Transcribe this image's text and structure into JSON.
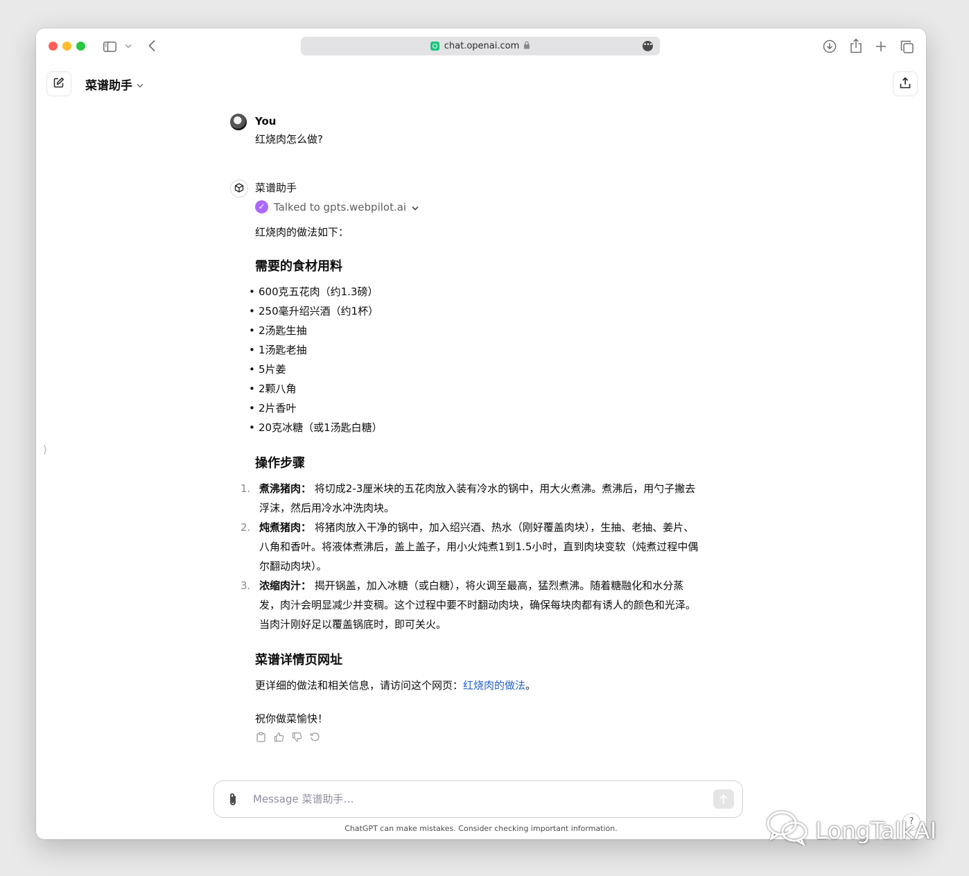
{
  "browser": {
    "url": "chat.openai.com"
  },
  "header": {
    "gpt_name": "菜谱助手"
  },
  "conversation": {
    "user": {
      "name": "You",
      "message": "红烧肉怎么做?"
    },
    "assistant": {
      "name": "菜谱助手",
      "tool_status": "Talked to gpts.webpilot.ai",
      "intro": "红烧肉的做法如下：",
      "ingredients_heading": "需要的食材用料",
      "ingredients": [
        "600克五花肉（约1.3磅）",
        "250毫升绍兴酒（约1杯）",
        "2汤匙生抽",
        "1汤匙老抽",
        "5片姜",
        "2颗八角",
        "2片香叶",
        "20克冰糖（或1汤匙白糖）"
      ],
      "steps_heading": "操作步骤",
      "steps": [
        {
          "num": "1.",
          "title": "煮沸猪肉：",
          "text": "将切成2-3厘米块的五花肉放入装有冷水的锅中，用大火煮沸。煮沸后，用勺子撇去浮沫，然后用冷水冲洗肉块。"
        },
        {
          "num": "2.",
          "title": "炖煮猪肉：",
          "text": "将猪肉放入干净的锅中，加入绍兴酒、热水（刚好覆盖肉块），生抽、老抽、姜片、八角和香叶。将液体煮沸后，盖上盖子，用小火炖煮1到1.5小时，直到肉块变软（炖煮过程中偶尔翻动肉块）。"
        },
        {
          "num": "3.",
          "title": "浓缩肉汁：",
          "text": "揭开锅盖，加入冰糖（或白糖），将火调至最高，猛烈煮沸。随着糖融化和水分蒸发，肉汁会明显减少并变稠。这个过程中要不时翻动肉块，确保每块肉都有诱人的颜色和光泽。当肉汁刚好足以覆盖锅底时，即可关火。"
        }
      ],
      "details_heading": "菜谱详情页网址",
      "details_text": "更详细的做法和相关信息，请访问这个网页：",
      "details_link": "红烧肉的做法",
      "details_end": "。",
      "closing": "祝你做菜愉快！"
    }
  },
  "composer": {
    "placeholder": "Message 菜谱助手…"
  },
  "disclaimer": "ChatGPT can make mistakes. Consider checking important information.",
  "help_label": "?",
  "watermark": "LongTalkAI",
  "colors": {
    "tool_check": "#ab68ff",
    "link": "#2462c5"
  }
}
